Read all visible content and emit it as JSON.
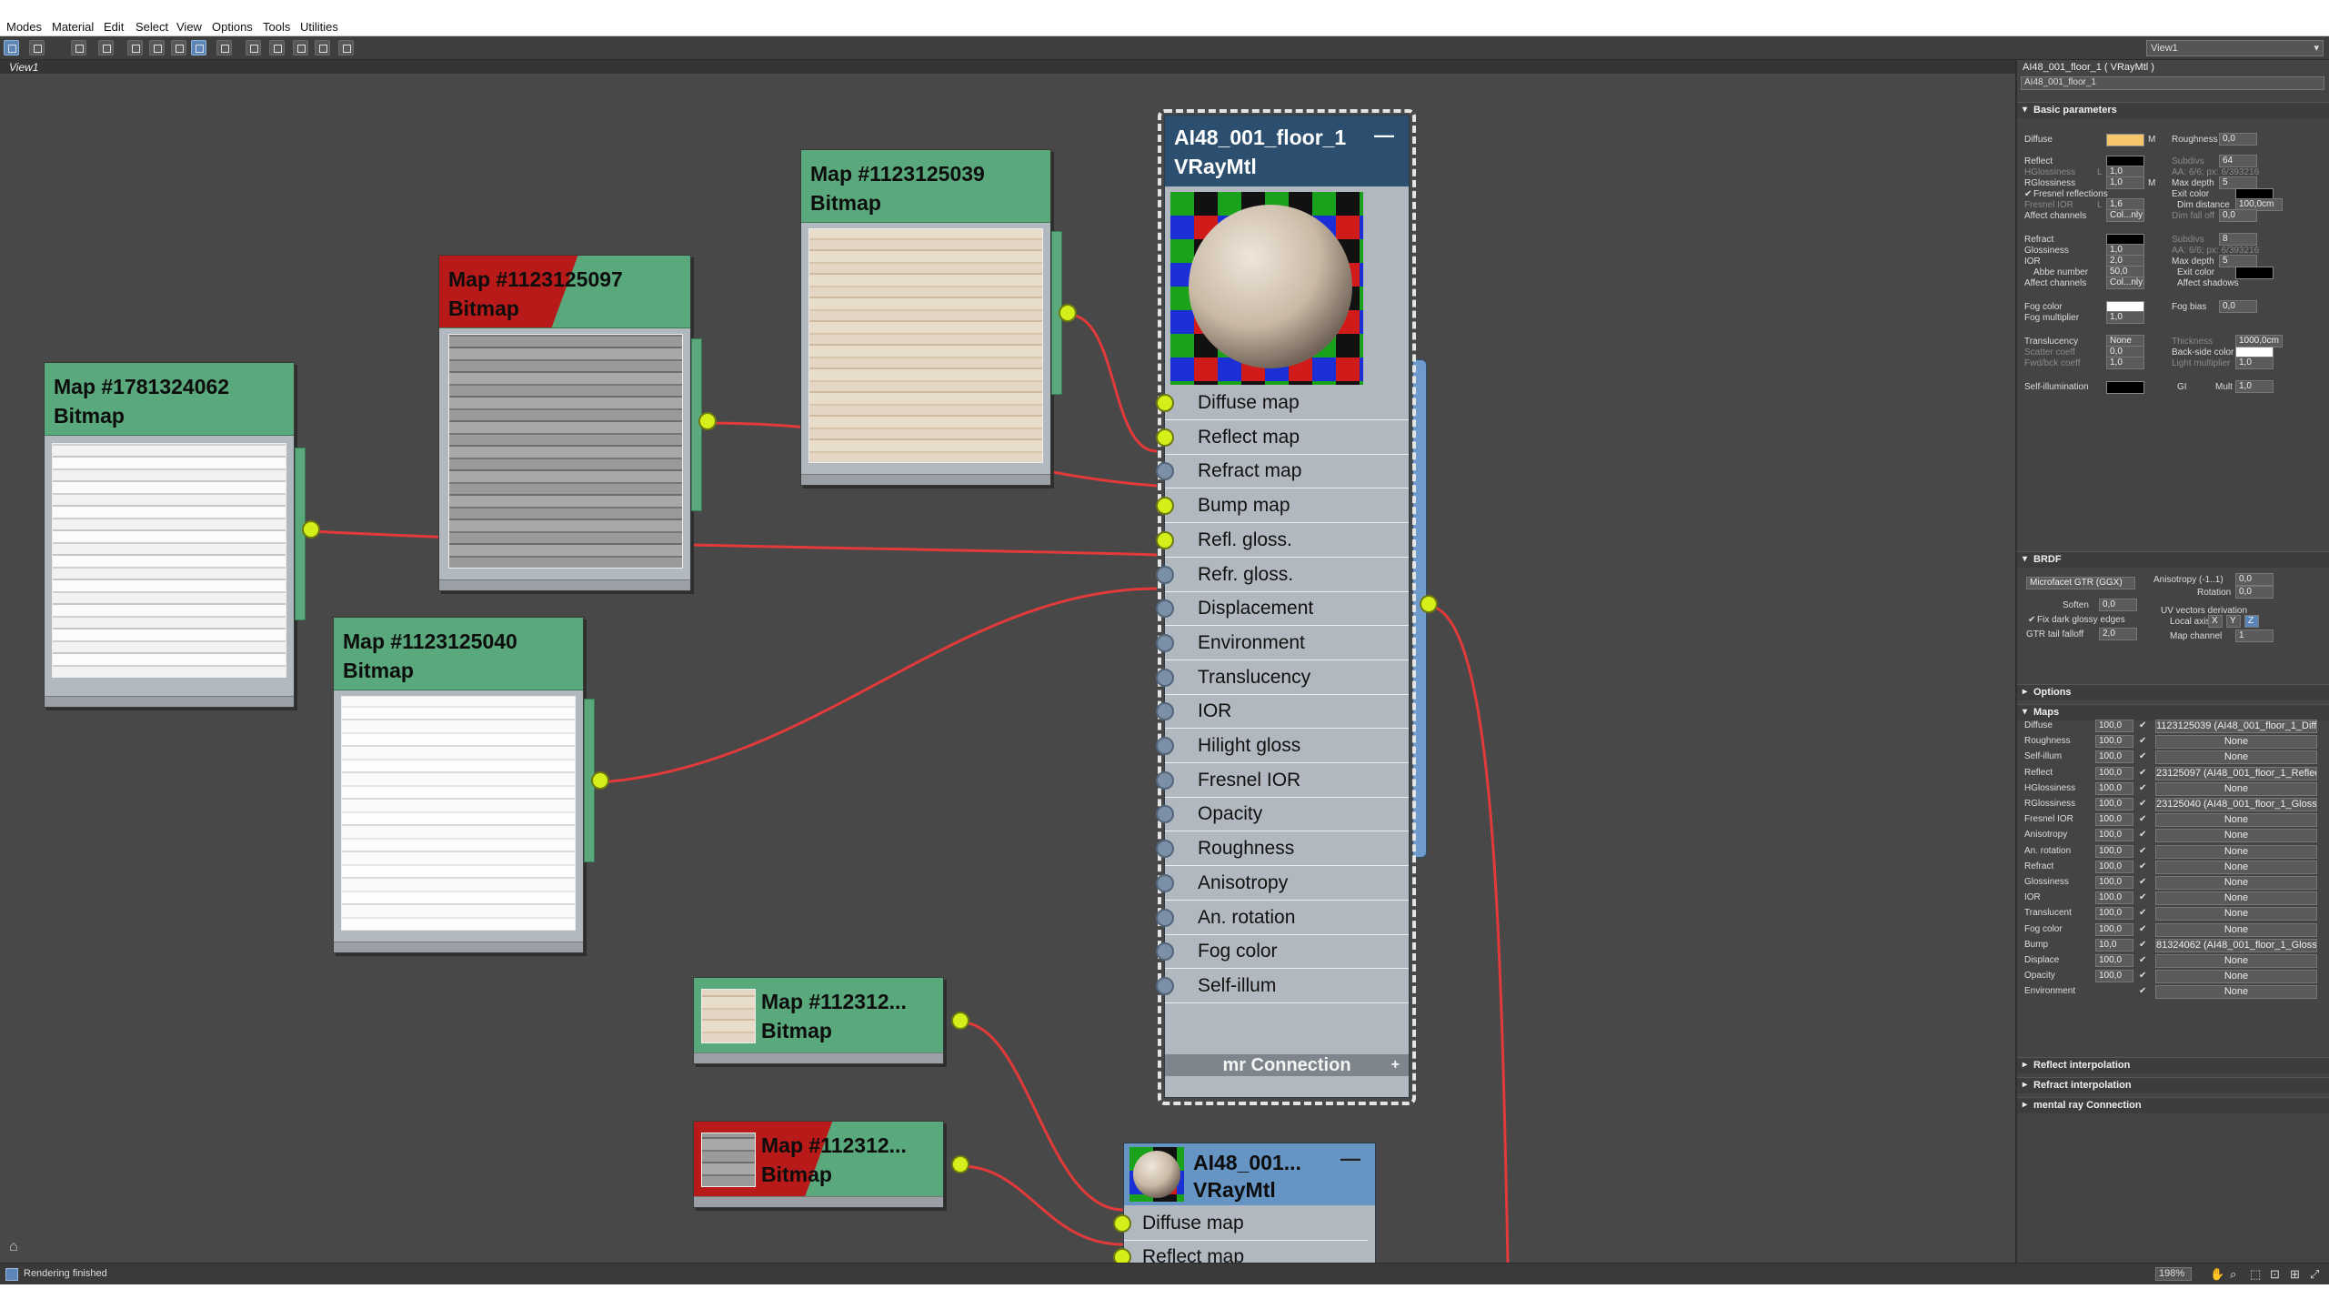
{
  "menubar": {
    "items": [
      "Modes",
      "Material",
      "Edit",
      "Select",
      "View",
      "Options",
      "Tools",
      "Utilities"
    ]
  },
  "view_selector": "View1",
  "view_tab": "View1",
  "nodes": [
    {
      "title": "Map #1781324062",
      "type": "Bitmap"
    },
    {
      "title": "Map #1123125097",
      "type": "Bitmap"
    },
    {
      "title": "Map #1123125039",
      "type": "Bitmap"
    },
    {
      "title": "Map #1123125040",
      "type": "Bitmap"
    },
    {
      "title": "Map #112312...",
      "type": "Bitmap"
    },
    {
      "title": "Map #112312...",
      "type": "Bitmap"
    }
  ],
  "material_main": {
    "title": "AI48_001_floor_1",
    "type": "VRayMtl",
    "minimize": "—",
    "slots": [
      "Diffuse map",
      "Reflect map",
      "Refract map",
      "Bump map",
      "Refl. gloss.",
      "Refr. gloss.",
      "Displacement",
      "Environment",
      "Translucency",
      "IOR",
      "Hilight gloss",
      "Fresnel IOR",
      "Opacity",
      "Roughness",
      "Anisotropy",
      "An. rotation",
      "Fog color",
      "Self-illum"
    ],
    "connected": [
      true,
      true,
      false,
      true,
      true,
      false,
      false,
      false,
      false,
      false,
      false,
      false,
      false,
      false,
      false,
      false,
      false,
      false
    ],
    "mr_connection": "mr Connection",
    "mr_plus": "+"
  },
  "material_second": {
    "title": "AI48_001...",
    "type": "VRayMtl",
    "minimize": "—",
    "slots": [
      "Diffuse map",
      "Reflect map"
    ]
  },
  "panel": {
    "header": "AI48_001_floor_1  ( VRayMtl )",
    "name_field": "AI48_001_floor_1",
    "basic": {
      "title": "Basic parameters",
      "diffuse": "Diffuse",
      "diffuse_color": "#f4c56a",
      "m": "M",
      "roughness": "Roughness",
      "roughness_val": "0,0",
      "reflect": "Reflect",
      "subdivs": "Subdivs",
      "subdivs_val": "64",
      "hglossiness": "HGlossiness",
      "hgloss_l": "L",
      "hgloss_val": "1,0",
      "aa": "AA: 6/6; px: 6/393216",
      "rglossiness": "RGlossiness",
      "rgloss_val": "1,0",
      "max_depth": "Max depth",
      "max_depth_val": "5",
      "fresnel_reflections": "Fresnel reflections",
      "exit_color": "Exit color",
      "fresnel_ior": "Fresnel IOR",
      "fresnel_ior_l": "L",
      "fresnel_ior_val": "1,6",
      "dim_distance": "Dim distance",
      "dim_distance_val": "100,0cm",
      "affect_channels": "Affect channels",
      "affect_channels_val": "Col...nly",
      "dim_fall_off": "Dim fall off",
      "dim_fall_off_val": "0,0",
      "refract": "Refract",
      "refract_subdivs_val": "8",
      "glossiness": "Glossiness",
      "glossiness_val": "1,0",
      "aa2": "AA: 6/6; px: 6/393216",
      "ior": "IOR",
      "ior_val": "2,0",
      "max_depth2_val": "5",
      "abbe_number": "Abbe number",
      "abbe_val": "50,0",
      "exit_color2": "Exit color",
      "affect_channels2_val": "Col...nly",
      "affect_shadows": "Affect shadows",
      "fog_color": "Fog color",
      "fog_bias": "Fog bias",
      "fog_bias_val": "0,0",
      "fog_multiplier": "Fog multiplier",
      "fog_mult_val": "1,0",
      "translucency": "Translucency",
      "translucency_val": "None",
      "thickness": "Thickness",
      "thickness_val": "1000,0cm",
      "scatter_coeff": "Scatter coeff",
      "scatter_val": "0,0",
      "back_side_color": "Back-side color",
      "fwd_bck_coeff": "Fwd/bck coeff",
      "fwd_val": "1,0",
      "light_multiplier": "Light multiplier",
      "light_mult_val": "1,0",
      "self_illumination": "Self-illumination",
      "gi": "GI",
      "mult": "Mult",
      "mult_val": "1,0"
    },
    "brdf": {
      "title": "BRDF",
      "type": "Microfacet GTR (GGX)",
      "anisotropy": "Anisotropy (-1..1)",
      "anisotropy_val": "0,0",
      "rotation": "Rotation",
      "rotation_val": "0,0",
      "soften": "Soften",
      "soften_val": "0,0",
      "uv_vectors": "UV vectors derivation",
      "fix_dark": "Fix dark glossy edges",
      "local_axis": "Local axis",
      "x": "X",
      "y": "Y",
      "z": "Z",
      "gtr_tail": "GTR tail falloff",
      "gtr_val": "2,0",
      "map_channel": "Map channel",
      "map_channel_val": "1"
    },
    "options_title": "Options",
    "maps_title": "Maps",
    "maps": [
      {
        "name": "Diffuse",
        "amount": "100,0",
        "map": "1123125039 (AI48_001_floor_1_Diffu"
      },
      {
        "name": "Roughness",
        "amount": "100,0",
        "map": "None"
      },
      {
        "name": "Self-illum",
        "amount": "100,0",
        "map": "None"
      },
      {
        "name": "Reflect",
        "amount": "100,0",
        "map": "23125097 (AI48_001_floor_1_Reflect"
      },
      {
        "name": "HGlossiness",
        "amount": "100,0",
        "map": "None"
      },
      {
        "name": "RGlossiness",
        "amount": "100,0",
        "map": "23125040 (AI48_001_floor_1_Glossir"
      },
      {
        "name": "Fresnel IOR",
        "amount": "100,0",
        "map": "None"
      },
      {
        "name": "Anisotropy",
        "amount": "100,0",
        "map": "None"
      },
      {
        "name": "An. rotation",
        "amount": "100,0",
        "map": "None"
      },
      {
        "name": "Refract",
        "amount": "100,0",
        "map": "None"
      },
      {
        "name": "Glossiness",
        "amount": "100,0",
        "map": "None"
      },
      {
        "name": "IOR",
        "amount": "100,0",
        "map": "None"
      },
      {
        "name": "Translucent",
        "amount": "100,0",
        "map": "None"
      },
      {
        "name": "Fog color",
        "amount": "100,0",
        "map": "None"
      },
      {
        "name": "Bump",
        "amount": "10,0",
        "map": "81324062 (AI48_001_floor_1_Glossir"
      },
      {
        "name": "Displace",
        "amount": "100,0",
        "map": "None"
      },
      {
        "name": "Opacity",
        "amount": "100,0",
        "map": "None"
      },
      {
        "name": "Environment",
        "amount": "",
        "map": "None"
      }
    ],
    "reflect_interp": "Reflect interpolation",
    "refract_interp": "Refract interpolation",
    "mental_ray": "mental ray Connection"
  },
  "status": {
    "text": "Rendering finished",
    "zoom": "198%"
  }
}
